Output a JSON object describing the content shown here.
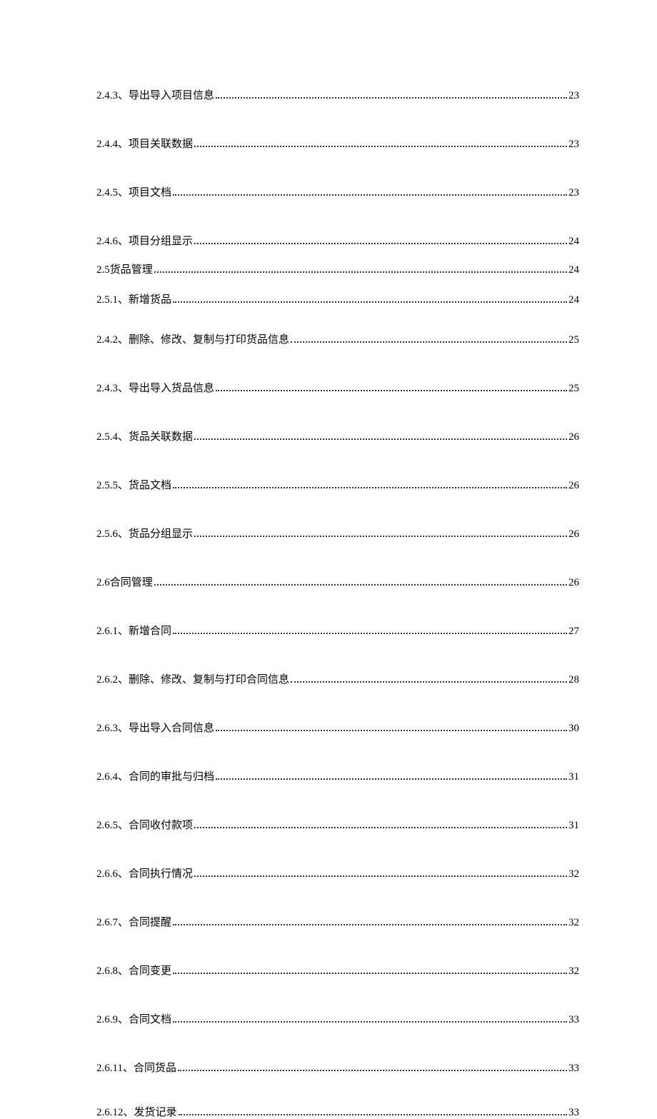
{
  "toc": [
    {
      "num": "2.4.3",
      "sep": "、",
      "title": "导出导入项目信息",
      "page": "23",
      "gap": 50,
      "alt": false
    },
    {
      "num": "2.4.4",
      "sep": "、",
      "title": "项目关联数据",
      "page": "23",
      "gap": 50,
      "alt": false
    },
    {
      "num": "2.4.5",
      "sep": "、",
      "title": "项目文档",
      "page": "23",
      "gap": 50,
      "alt": false
    },
    {
      "num": "2.4.6",
      "sep": "、",
      "title": "项目分组显示",
      "page": "24",
      "gap": 50,
      "alt": false
    },
    {
      "num": "2.5",
      "sep": " ",
      "title": "货品管理",
      "page": "24",
      "gap": 22,
      "alt": false
    },
    {
      "num": "2.5.1",
      "sep": "、",
      "title": "新增货品",
      "page": "24",
      "gap": 24,
      "alt": true
    },
    {
      "num": "2.4.2",
      "sep": "、",
      "title": "删除、修改、复制与打印货品信息",
      "page": "25",
      "gap": 38,
      "alt": false
    },
    {
      "num": "2.4.3",
      "sep": "、",
      "title": "导出导入货品信息",
      "page": "25",
      "gap": 50,
      "alt": false
    },
    {
      "num": "2.5.4",
      "sep": "、",
      "title": "货品关联数据",
      "page": "26",
      "gap": 50,
      "alt": false
    },
    {
      "num": "2.5.5",
      "sep": "、",
      "title": "货品文档",
      "page": "26",
      "gap": 50,
      "alt": false
    },
    {
      "num": "2.5.6",
      "sep": "、",
      "title": "货品分组显示",
      "page": "26",
      "gap": 50,
      "alt": false
    },
    {
      "num": "2.6",
      "sep": " ",
      "title": "合同管理",
      "page": "26",
      "gap": 50,
      "alt": false
    },
    {
      "num": "2.6.1",
      "sep": "、",
      "title": "新增合同",
      "page": "27",
      "gap": 50,
      "alt": false
    },
    {
      "num": "2.6.2",
      "sep": "、",
      "title": "删除、修改、复制与打印合同信息",
      "page": "28",
      "gap": 50,
      "alt": false
    },
    {
      "num": "2.6.3",
      "sep": "、",
      "title": "导出导入合同信息",
      "page": "30",
      "gap": 50,
      "alt": false
    },
    {
      "num": "2.6.4",
      "sep": "、",
      "title": "合同的审批与归档",
      "page": "31",
      "gap": 50,
      "alt": false
    },
    {
      "num": "2.6.5",
      "sep": "、",
      "title": "合同收付款项",
      "page": "31",
      "gap": 50,
      "alt": false
    },
    {
      "num": "2.6.6",
      "sep": "、",
      "title": "合同执行情况",
      "page": "32",
      "gap": 50,
      "alt": false
    },
    {
      "num": "2.6.7",
      "sep": "、",
      "title": "合同提醒",
      "page": "32",
      "gap": 50,
      "alt": false
    },
    {
      "num": "2.6.8",
      "sep": "、",
      "title": "合同变更",
      "page": "32",
      "gap": 50,
      "alt": false
    },
    {
      "num": "2.6.9",
      "sep": "、",
      "title": "合同文档",
      "page": "33",
      "gap": 50,
      "alt": false
    },
    {
      "num": "2.6.11",
      "sep": "、",
      "title": "合同货品 ",
      "page": "33",
      "gap": 50,
      "alt": false
    },
    {
      "num": "2.6.12",
      "sep": "、",
      "title": "发货记录 ",
      "page": "33",
      "gap": 44,
      "alt": false
    }
  ]
}
